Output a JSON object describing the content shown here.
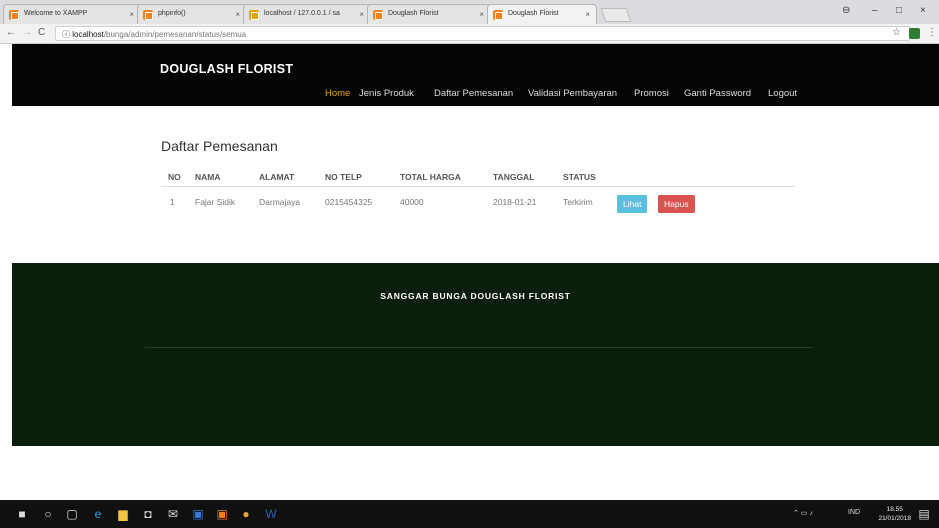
{
  "browser": {
    "tabs": [
      {
        "label": "Welcome to XAMPP",
        "active": false
      },
      {
        "label": "phpinfo()",
        "active": false
      },
      {
        "label": "localhost / 127.0.0.1 / sa",
        "active": false
      },
      {
        "label": "Douglash Florist",
        "active": false
      },
      {
        "label": "Douglash Florist",
        "active": true
      }
    ],
    "tab_close": "×",
    "url_host": "localhost",
    "url_path": "/bunga/admin/pemesanan/status/semua",
    "icons": {
      "back": "←",
      "forward": "→",
      "reload": "C",
      "info": "ⓘ",
      "star": "☆",
      "menu": "⋮",
      "account": "⊖",
      "minimize": "–",
      "maximize": "□",
      "close": "×"
    }
  },
  "navbar": {
    "brand": "DOUGLASH FLORIST",
    "menu": [
      {
        "label": "Home",
        "active": true
      },
      {
        "label": "Jenis Produk",
        "active": false
      },
      {
        "label": "Daftar Pemesanan",
        "active": false
      },
      {
        "label": "Validasi Pembayaran",
        "active": false
      },
      {
        "label": "Promosi",
        "active": false
      },
      {
        "label": "Ganti Password",
        "active": false
      },
      {
        "label": "Logout",
        "active": false
      }
    ]
  },
  "main": {
    "title": "Daftar Pemesanan",
    "columns": [
      "NO",
      "NAMA",
      "ALAMAT",
      "NO TELP",
      "TOTAL HARGA",
      "TANGGAL",
      "STATUS"
    ],
    "rows": [
      {
        "no": "1",
        "nama": "Fajar Sidik",
        "alamat": "Darmajaya",
        "no_telp": "0215454325",
        "total_harga": "40000",
        "tanggal": "2018-01-21",
        "status": "Terkirim"
      }
    ],
    "actions": {
      "view": "Lihat",
      "delete": "Hapus"
    },
    "colors": {
      "view": "#5bc0de",
      "delete": "#d9534f",
      "active_menu": "#f0a30a"
    }
  },
  "footer": {
    "title": "SANGGAR BUNGA DOUGLASH FLORIST"
  },
  "taskbar": {
    "lang": "IND",
    "time": "18.55",
    "date": "21/01/2018"
  }
}
